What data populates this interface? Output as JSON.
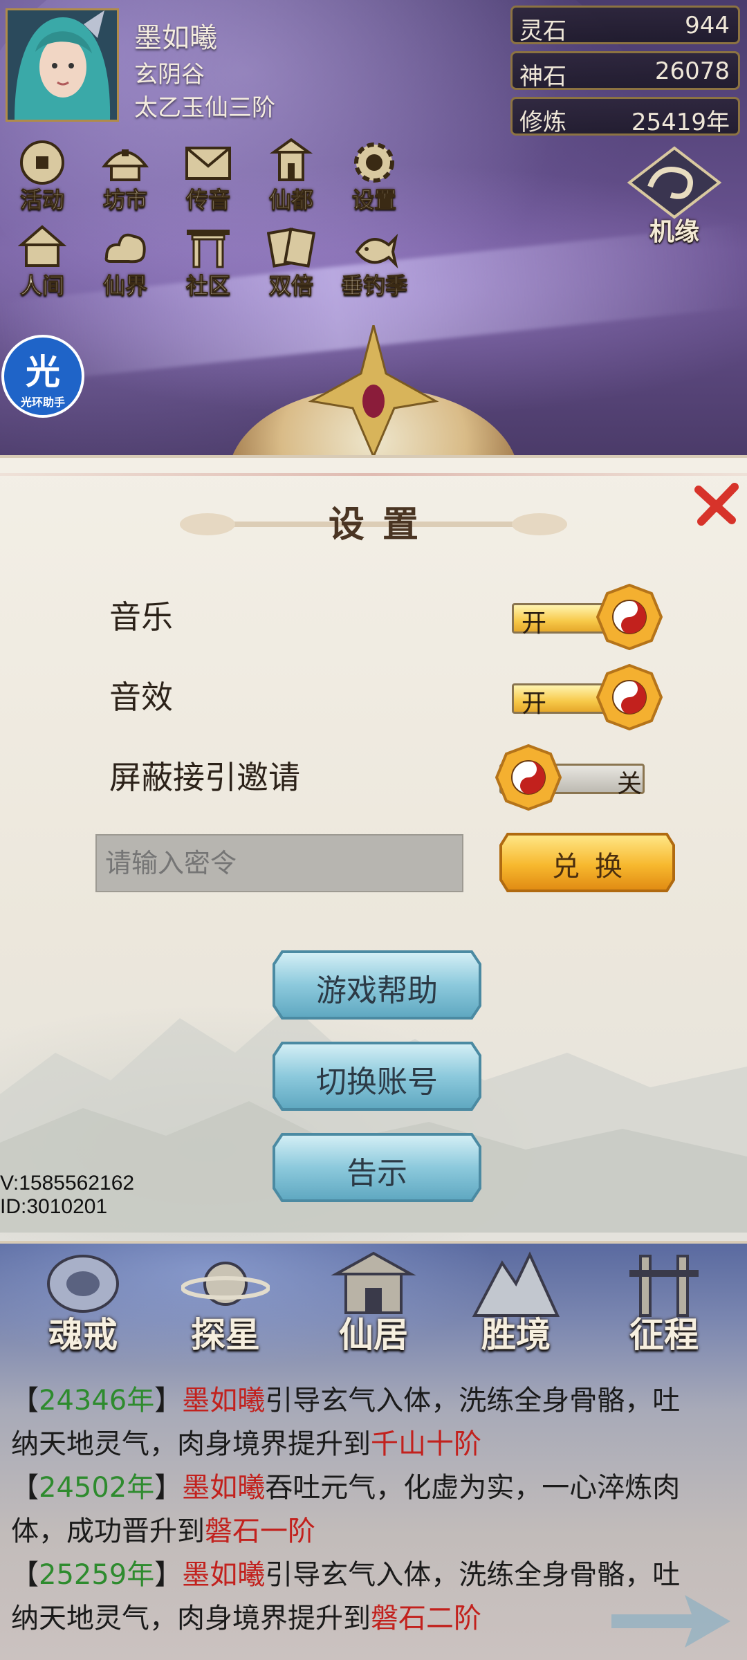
{
  "player": {
    "name": "墨如曦",
    "sect": "玄阴谷",
    "rank": "太乙玉仙三阶"
  },
  "resources": [
    {
      "label": "灵石",
      "value": "944"
    },
    {
      "label": "神石",
      "value": "26078"
    },
    {
      "label": "修炼",
      "value": "25419年"
    }
  ],
  "top_menu_row1": [
    "活动",
    "坊市",
    "传音",
    "仙都",
    "设置"
  ],
  "top_menu_row2": [
    "人间",
    "仙界",
    "社区",
    "双倍",
    "垂钓季"
  ],
  "side_button": "机缘",
  "helper": {
    "glyph": "光",
    "label": "光环助手"
  },
  "dialog": {
    "title": "设置",
    "settings": [
      {
        "label": "音乐",
        "state": "开"
      },
      {
        "label": "音效",
        "state": "开"
      },
      {
        "label": "屏蔽接引邀请",
        "state": "关"
      }
    ],
    "code_placeholder": "请输入密令",
    "redeem_label": "兑换",
    "buttons": [
      "游戏帮助",
      "切换账号",
      "告示"
    ],
    "version": "V:1585562162",
    "id": "ID:3010201"
  },
  "bottom_nav": [
    "魂戒",
    "探星",
    "仙居",
    "胜境",
    "征程"
  ],
  "log": [
    {
      "open": "【",
      "year": "24346年",
      "close": "】",
      "name": "墨如曦",
      "line1_rest": "引导玄气入体，洗练全身骨骼，吐",
      "line2": "纳天地灵气，肉身境界提升到",
      "rank": "千山十阶"
    },
    {
      "open": "【",
      "year": "24502年",
      "close": "】",
      "name": "墨如曦",
      "line1_rest": "吞吐元气，化虚为实，一心淬炼肉",
      "line2": "体，成功晋升到",
      "rank": "磐石一阶"
    },
    {
      "open": "【",
      "year": "25259年",
      "close": "】",
      "name": "墨如曦",
      "line1_rest": "引导玄气入体，洗练全身骨骼，吐",
      "line2": "纳天地灵气，肉身境界提升到",
      "rank": "磐石二阶"
    }
  ],
  "colors": {
    "year_green": "#2e8b2e",
    "highlight_red": "#c2211d",
    "toggle_on_gold": "#f7c94a",
    "button_blue": "#8cc9dc"
  }
}
